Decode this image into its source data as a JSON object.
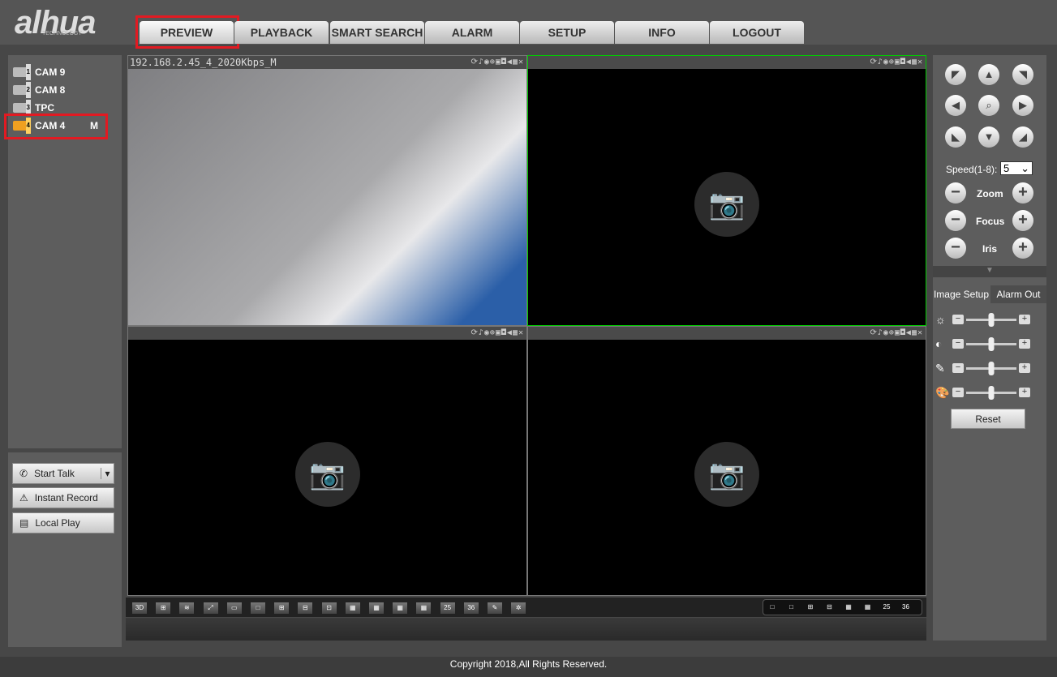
{
  "logo": {
    "brand": "alhua",
    "sub": "TECHNOLOGY"
  },
  "tabs": [
    "PREVIEW",
    "PLAYBACK",
    "SMART SEARCH",
    "ALARM",
    "SETUP",
    "INFO",
    "LOGOUT"
  ],
  "cameras": [
    {
      "name": "CAM 9",
      "num": "1"
    },
    {
      "name": "CAM 8",
      "num": "2"
    },
    {
      "name": "TPC",
      "num": "3"
    },
    {
      "name": "CAM 4",
      "num": "4",
      "stream": "M"
    }
  ],
  "actions": {
    "talk": "Start Talk",
    "record": "Instant Record",
    "local_play": "Local Play"
  },
  "video": {
    "cell1_title": "192.168.2.45_4_2020Kbps_M",
    "cell_icons": "⟳♪◉⊕▣◘◀▦✕"
  },
  "toolbar": {
    "left": [
      "3D",
      "⊞",
      "≋",
      "⤢",
      "▭",
      "□",
      "⊞",
      "⊟",
      "⊡",
      "▦",
      "▦",
      "▦",
      "▦",
      "25",
      "36",
      "✎",
      "✲"
    ],
    "right": [
      "□",
      "□",
      "⊞",
      "⊟",
      "▦",
      "▦",
      "25",
      "36"
    ]
  },
  "ptz": {
    "speed_label": "Speed(1-8):",
    "speed_value": "5",
    "zoom": "Zoom",
    "focus": "Focus",
    "iris": "Iris"
  },
  "image_setup": {
    "tab1": "Image Setup",
    "tab2": "Alarm Out",
    "sliders": [
      {
        "name": "brightness",
        "value": 0.5
      },
      {
        "name": "contrast",
        "value": 0.5
      },
      {
        "name": "saturation",
        "value": 0.5
      },
      {
        "name": "hue",
        "value": 0.5
      }
    ],
    "reset": "Reset"
  },
  "footer": "Copyright 2018,All Rights Reserved."
}
